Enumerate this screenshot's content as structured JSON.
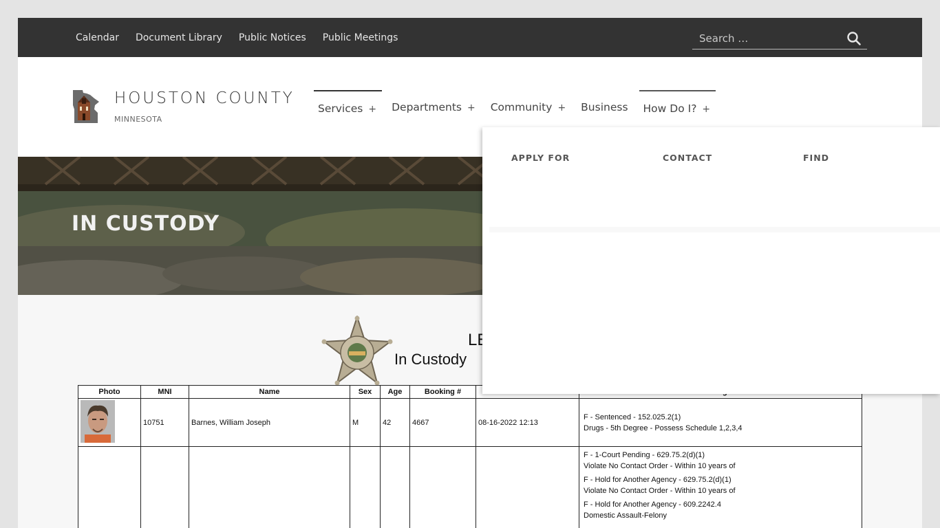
{
  "topbar": {
    "links": [
      "Calendar",
      "Document Library",
      "Public Notices",
      "Public Meetings"
    ],
    "search_placeholder": "Search …"
  },
  "site": {
    "title": "HOUSTON COUNTY",
    "subtitle": "MINNESOTA"
  },
  "mainnav": {
    "items": [
      {
        "label": "Services",
        "plus": "+"
      },
      {
        "label": "Departments",
        "plus": "+"
      },
      {
        "label": "Community",
        "plus": "+"
      },
      {
        "label": "Business",
        "plus": ""
      },
      {
        "label": "How Do I?",
        "plus": "+"
      }
    ]
  },
  "mega_menu": {
    "headings": [
      "APPLY FOR",
      "CONTACT",
      "FIND"
    ]
  },
  "hero": {
    "title": "IN CUSTODY"
  },
  "report": {
    "title": "LE",
    "subtitle": "In Custody"
  },
  "table": {
    "headers": [
      "Photo",
      "MNI",
      "Name",
      "Sex",
      "Age",
      "Booking #",
      "",
      "Charges"
    ],
    "rows": [
      {
        "mni": "10751",
        "name": "Barnes, William Joseph",
        "sex": "M",
        "age": "42",
        "booking": "4667",
        "intake": "08-16-2022 12:13",
        "charges": [
          "F  -  Sentenced            -  152.025.2(1)",
          "Drugs - 5th Degree - Possess Schedule 1,2,3,4"
        ]
      },
      {
        "mni": "",
        "name": "",
        "sex": "",
        "age": "",
        "booking": "",
        "intake": "",
        "charges": [
          "F  -  1-Court Pending                -  629.75.2(d)(1)",
          "Violate No Contact Order - Within 10 years of",
          "F  -  Hold for Another Agency    -  629.75.2(d)(1)",
          "Violate No Contact Order - Within 10 years of",
          "F  -  Hold for Another Agency    -  609.2242.4",
          "Domestic Assault-Felony"
        ]
      }
    ]
  },
  "colors": {
    "topbar_bg": "#333333",
    "header_bg": "#ffffff",
    "page_bg": "#f7f7f7",
    "text_dark": "#333333"
  }
}
